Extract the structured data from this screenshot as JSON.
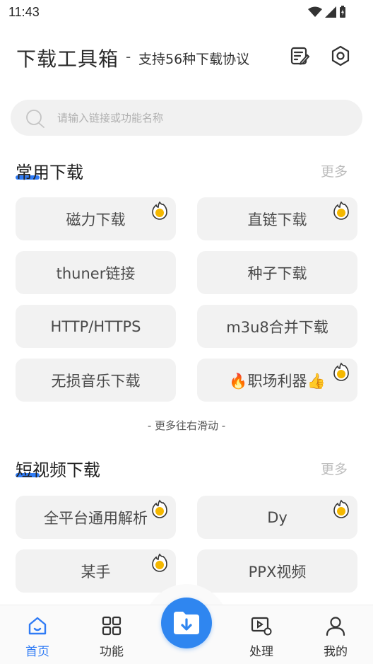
{
  "status_bar": {
    "time": "11:43"
  },
  "header": {
    "title": "下载工具箱",
    "separator": "-",
    "subtitle": "支持56种下载协议",
    "icons": [
      "notes-edit-icon",
      "settings-gear-icon"
    ]
  },
  "search": {
    "placeholder": "请输入链接或功能名称",
    "icon": "search-icon"
  },
  "common_section": {
    "title": "常用下载",
    "more": "更多",
    "items": [
      {
        "label": "磁力下载",
        "hot": true
      },
      {
        "label": "直链下载",
        "hot": true
      },
      {
        "label": "thuner链接",
        "hot": false
      },
      {
        "label": "种子下载",
        "hot": false
      },
      {
        "label": "HTTP/HTTPS",
        "hot": false
      },
      {
        "label": "m3u8合并下载",
        "hot": false
      },
      {
        "label": "无损音乐下载",
        "hot": false
      },
      {
        "label": "🔥职场利器👍",
        "hot": true
      }
    ]
  },
  "scroll_hint": "- 更多往右滑动 -",
  "video_section": {
    "title": "短视频下载",
    "more": "更多",
    "items": [
      {
        "label": "全平台通用解析",
        "hot": true
      },
      {
        "label": "Dy",
        "hot": true
      },
      {
        "label": "某手",
        "hot": true
      },
      {
        "label": "PPX视频",
        "hot": false
      }
    ]
  },
  "bottom_nav": {
    "items": [
      {
        "label": "首页",
        "icon": "home-icon",
        "active": true
      },
      {
        "label": "功能",
        "icon": "grid-icon",
        "active": false
      },
      {
        "label": "处理",
        "icon": "video-settings-icon",
        "active": false
      },
      {
        "label": "我的",
        "icon": "person-icon",
        "active": false
      }
    ],
    "center_button_icon": "download-folder-icon"
  },
  "colors": {
    "accent": "#2f7bf5",
    "tile_bg": "#f2f2f2",
    "hot_badge": "#f5b800"
  }
}
